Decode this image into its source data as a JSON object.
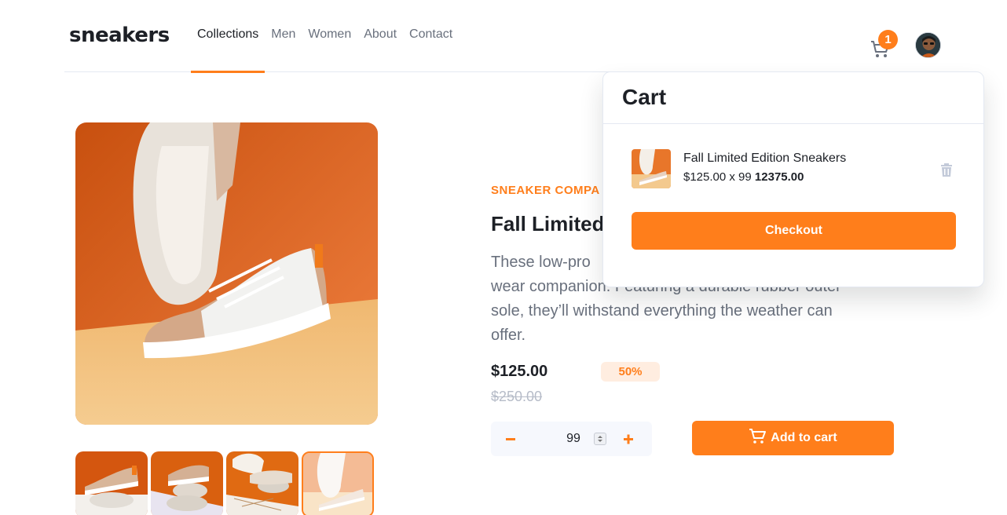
{
  "brand": {
    "logo_text": "sneakers",
    "accent": "#ff7e1b"
  },
  "nav": {
    "items": [
      {
        "label": "Collections",
        "active": true
      },
      {
        "label": "Men"
      },
      {
        "label": "Women"
      },
      {
        "label": "About"
      },
      {
        "label": "Contact"
      }
    ]
  },
  "header": {
    "cart_icon": "cart-icon",
    "cart_count": "1",
    "avatar": "user-avatar"
  },
  "gallery": {
    "main_image": "sneaker-pair-orange-background",
    "thumbnails": [
      "thumbnail-1",
      "thumbnail-2",
      "thumbnail-3",
      "thumbnail-4"
    ],
    "active_thumbnail": 4
  },
  "product": {
    "company": "SNEAKER COMPA",
    "title": "Fall Limited",
    "description_line1": "These low-pro",
    "description_line2": "wear companion. Featuring a durable rubber outer",
    "description_line3": "sole, they’ll withstand everything the weather can",
    "description_line4": "offer.",
    "price": "$125.00",
    "discount": "50%",
    "old_price": "$250.00"
  },
  "quantity": {
    "minus": "−",
    "value": "99",
    "plus": "+"
  },
  "add_to_cart": {
    "label": "Add to cart",
    "icon": "cart-icon"
  },
  "cart": {
    "title": "Cart",
    "item": {
      "name": "Fall Limited Edition Sneakers",
      "unit_price": "$125.00 x 99",
      "total": "12375.00",
      "delete_icon": "trash-icon"
    },
    "checkout_label": "Checkout"
  }
}
